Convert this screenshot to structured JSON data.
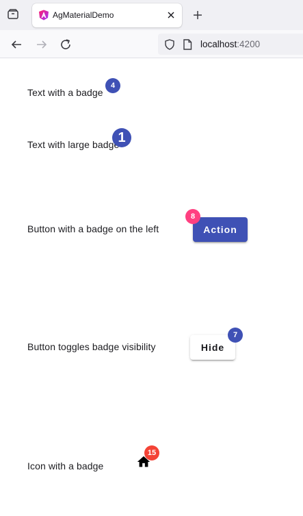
{
  "browser": {
    "tab_title": "AgMaterialDemo",
    "url_host": "localhost",
    "url_port": ":4200"
  },
  "colors": {
    "primary": "#3f51b5",
    "accent": "#ff4081",
    "warn": "#f44336"
  },
  "examples": {
    "text_badge": {
      "label": "Text with a badge",
      "badge": "4"
    },
    "large_badge": {
      "label": "Text with large badge",
      "badge": "1"
    },
    "button_left_badge": {
      "label": "Button with a badge on the left",
      "button_label": "Action",
      "badge": "8"
    },
    "toggle_badge": {
      "label": "Button toggles badge visibility",
      "button_label": "Hide",
      "badge": "7"
    },
    "icon_badge": {
      "label": "Icon with a badge",
      "icon": "home-icon",
      "badge": "15"
    }
  }
}
